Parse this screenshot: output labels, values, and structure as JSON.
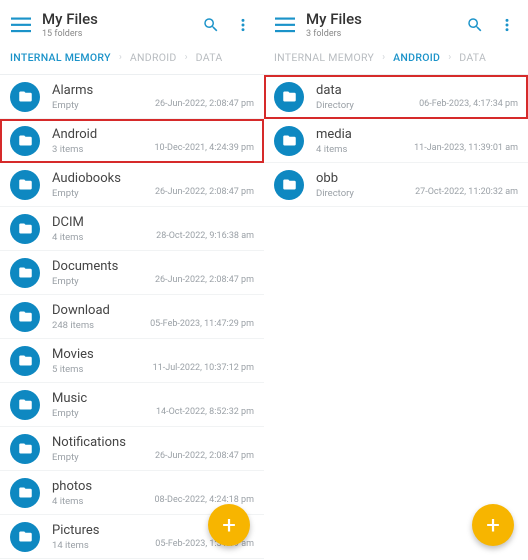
{
  "left": {
    "title": "My Files",
    "subtitle": "15 folders",
    "crumbs": [
      {
        "label": "INTERNAL MEMORY",
        "active": true
      },
      {
        "label": "ANDROID",
        "active": false
      },
      {
        "label": "DATA",
        "active": false
      }
    ],
    "items": [
      {
        "name": "Alarms",
        "sub": "Empty",
        "date": "26-Jun-2022, 2:08:47 pm",
        "hot": false
      },
      {
        "name": "Android",
        "sub": "3 items",
        "date": "10-Dec-2021, 4:24:39 pm",
        "hot": true
      },
      {
        "name": "Audiobooks",
        "sub": "Empty",
        "date": "26-Jun-2022, 2:08:47 pm",
        "hot": false
      },
      {
        "name": "DCIM",
        "sub": "4 items",
        "date": "28-Oct-2022, 9:16:38 am",
        "hot": false
      },
      {
        "name": "Documents",
        "sub": "Empty",
        "date": "26-Jun-2022, 2:08:47 pm",
        "hot": false
      },
      {
        "name": "Download",
        "sub": "248 items",
        "date": "05-Feb-2023, 11:47:29 pm",
        "hot": false
      },
      {
        "name": "Movies",
        "sub": "5 items",
        "date": "11-Jul-2022, 10:37:12 pm",
        "hot": false
      },
      {
        "name": "Music",
        "sub": "Empty",
        "date": "14-Oct-2022, 8:52:32 pm",
        "hot": false
      },
      {
        "name": "Notifications",
        "sub": "Empty",
        "date": "26-Jun-2022, 2:08:47 pm",
        "hot": false
      },
      {
        "name": "photos",
        "sub": "4 items",
        "date": "08-Dec-2022, 4:24:18 pm",
        "hot": false
      },
      {
        "name": "Pictures",
        "sub": "14 items",
        "date": "05-Feb-2023, 1:31:19 am",
        "hot": false
      }
    ]
  },
  "right": {
    "title": "My Files",
    "subtitle": "3 folders",
    "crumbs": [
      {
        "label": "INTERNAL MEMORY",
        "active": false
      },
      {
        "label": "ANDROID",
        "active": true
      },
      {
        "label": "DATA",
        "active": false
      }
    ],
    "items": [
      {
        "name": "data",
        "sub": "Directory",
        "date": "06-Feb-2023, 4:17:34 pm",
        "hot": true
      },
      {
        "name": "media",
        "sub": "4 items",
        "date": "11-Jan-2023, 11:39:01 am",
        "hot": false
      },
      {
        "name": "obb",
        "sub": "Directory",
        "date": "27-Oct-2022, 11:20:32 am",
        "hot": false
      }
    ]
  },
  "icons": {
    "accent": "#1b93c9"
  }
}
